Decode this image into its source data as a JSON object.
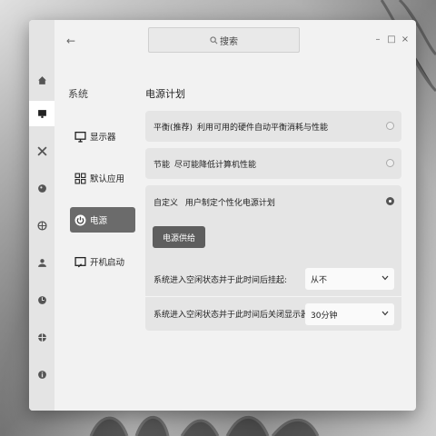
{
  "search": {
    "label": "搜索",
    "icon": "search-icon"
  },
  "window_controls": {
    "minimize": "–",
    "maximize": "□",
    "close": "×"
  },
  "rail": [
    "home-icon",
    "display-icon",
    "tools-icon",
    "palette-icon",
    "globe-icon",
    "user-icon",
    "clock-icon",
    "crosshair-icon",
    "info-icon"
  ],
  "nav": {
    "title": "系统",
    "items": [
      {
        "label": "显示器",
        "icon": "monitor-icon"
      },
      {
        "label": "默认应用",
        "icon": "apps-grid-icon"
      },
      {
        "label": "电源",
        "icon": "power-icon"
      },
      {
        "label": "开机启动",
        "icon": "startup-icon"
      }
    ],
    "active": "电源"
  },
  "main": {
    "title": "电源计划",
    "plans": [
      {
        "name": "平衡(推荐)",
        "desc": "利用可用的硬件自动平衡消耗与性能",
        "selected": false
      },
      {
        "name": "节能",
        "desc": "尽可能降低计算机性能",
        "selected": false
      },
      {
        "name": "自定义",
        "desc": "用户制定个性化电源计划",
        "selected": true
      }
    ],
    "supply_button": "电源供给",
    "settings": [
      {
        "label": "系统进入空闲状态并于此时间后挂起:",
        "value": "从不"
      },
      {
        "label": "系统进入空闲状态并于此时间后关闭显示器:",
        "value": "30分钟"
      }
    ]
  },
  "colors": {
    "active_nav": "#6b6b6b",
    "button": "#5e5e5e",
    "panel": "#e5e5e5"
  }
}
